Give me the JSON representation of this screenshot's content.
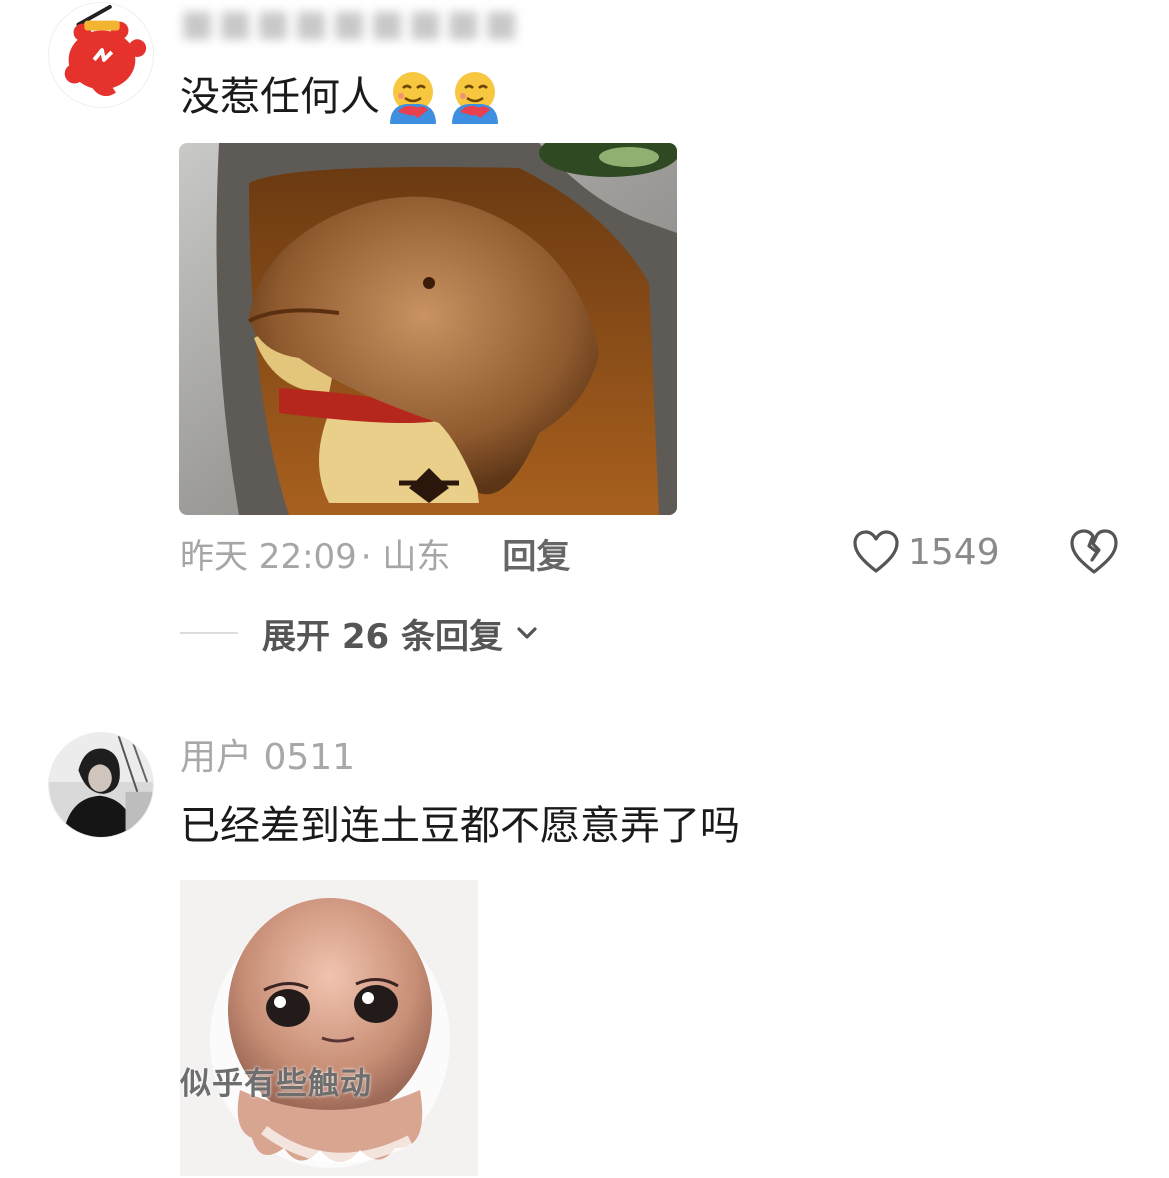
{
  "comments": [
    {
      "username": "■■■■■■■■■",
      "text": "没惹任何人",
      "emojis": [
        "hug-emoji",
        "hug-emoji"
      ],
      "time": "昨天 22:09",
      "location": "· 山东",
      "reply_label": "回复",
      "like_count": "1549",
      "expand_label": "展开 26 条回复"
    },
    {
      "username": "用户 0511",
      "text": "已经差到连土豆都不愿意弄了吗",
      "sticker_caption": "似乎有些触动"
    }
  ],
  "colors": {
    "meta_grey": "#a6a6a6",
    "avatar_red": "#e5322d",
    "text": "#1a1a1a"
  }
}
